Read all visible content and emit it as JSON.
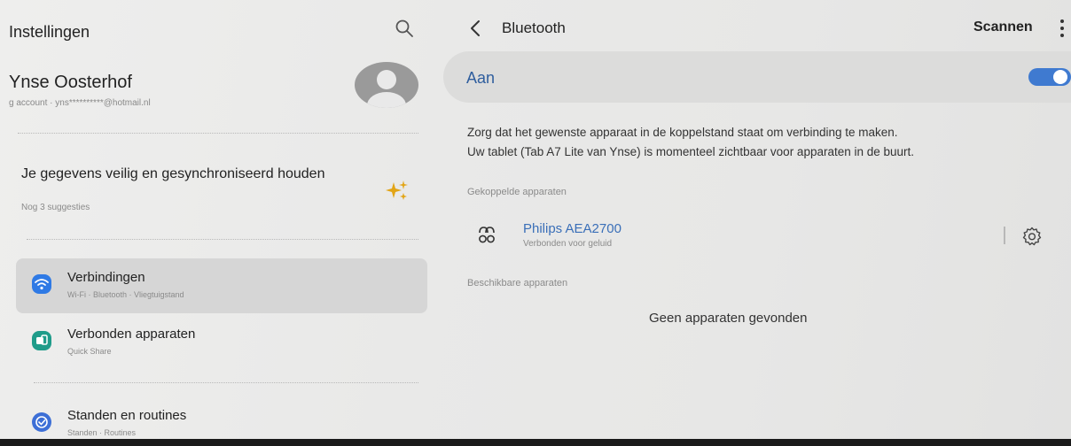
{
  "sidebar": {
    "title": "Instellingen",
    "search_icon": "search-icon",
    "profile": {
      "name": "Ynse Oosterhof",
      "subtitle": "g account · yns**********@hotmail.nl"
    },
    "suggestion": {
      "title": "Je gegevens veilig en gesynchroniseerd houden",
      "subtitle": "Nog 3 suggesties",
      "icon": "sparkle-icon"
    },
    "items": [
      {
        "label": "Verbindingen",
        "sub": "Wi-Fi · Bluetooth · Vliegtuigstand",
        "icon": "wifi-icon",
        "color": "#2f7ae5",
        "selected": true
      },
      {
        "label": "Verbonden apparaten",
        "sub": "Quick Share",
        "icon": "connected-devices-icon",
        "color": "#1f9c8a",
        "selected": false
      },
      {
        "label": "Standen en routines",
        "sub": "Standen · Routines",
        "icon": "modes-routines-icon",
        "color": "#3d6fd6",
        "selected": false
      }
    ]
  },
  "main": {
    "title": "Bluetooth",
    "scan_label": "Scannen",
    "toggle": {
      "label": "Aan",
      "on": true,
      "color": "#3f7ad0"
    },
    "info_lines": [
      "Zorg dat het gewenste apparaat in de koppelstand staat om verbinding te maken.",
      "Uw tablet (Tab A7 Lite van Ynse) is momenteel zichtbaar voor apparaten in de buurt."
    ],
    "paired_header": "Gekoppelde apparaten",
    "paired_devices": [
      {
        "name": "Philips AEA2700",
        "status": "Verbonden voor geluid",
        "icon": "audio-device-icon"
      }
    ],
    "available_header": "Beschikbare apparaten",
    "available_empty": "Geen apparaten gevonden"
  }
}
